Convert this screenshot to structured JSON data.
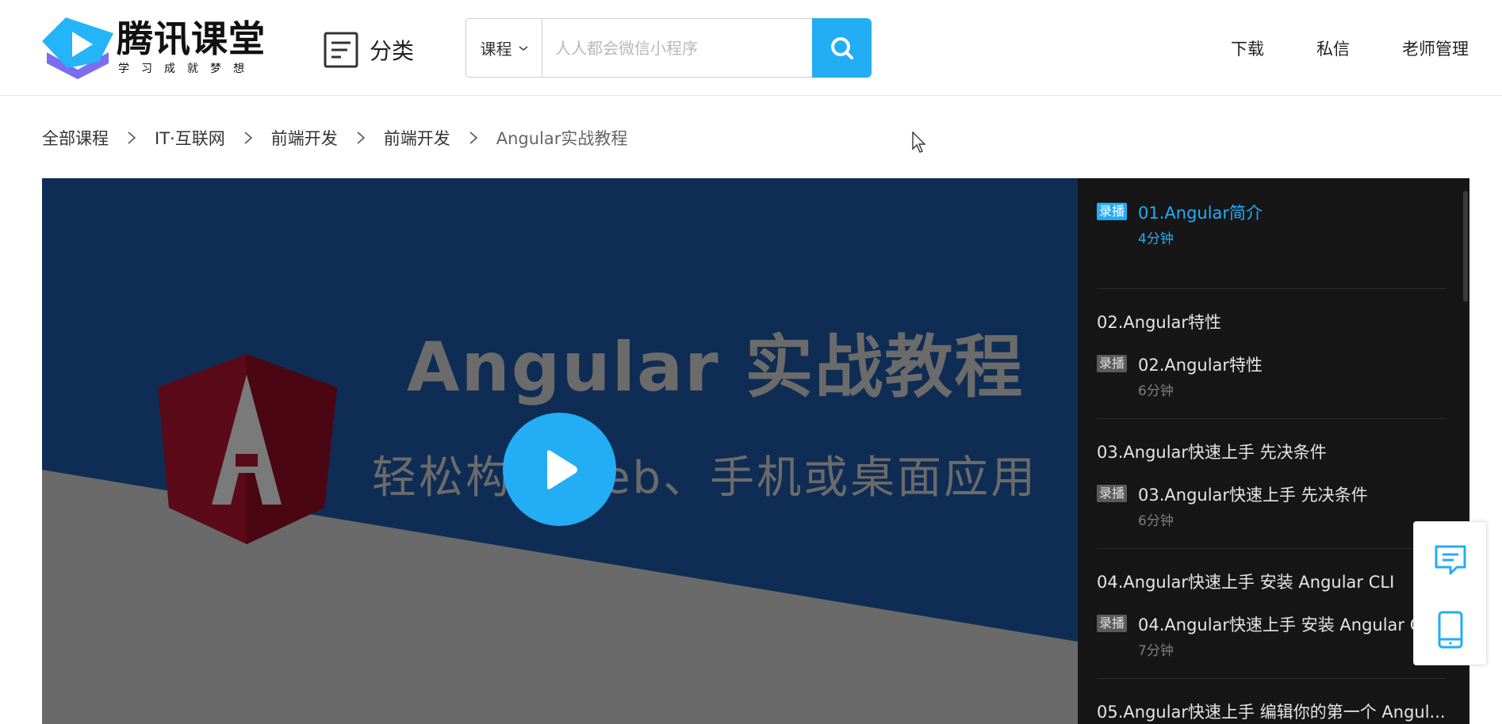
{
  "header": {
    "logo_title": "腾讯课堂",
    "logo_subtitle": "学习成就梦想",
    "category_label": "分类",
    "search": {
      "type_label": "课程",
      "placeholder": "人人都会微信小程序",
      "value": ""
    },
    "nav": [
      "下载",
      "私信",
      "老师管理"
    ]
  },
  "breadcrumb": [
    "全部课程",
    "IT·互联网",
    "前端开发",
    "前端开发",
    "Angular实战教程"
  ],
  "player": {
    "title": "Angular 实战教程",
    "subtitle": "轻松构建Web、手机或桌面应用",
    "logo_letter": "A"
  },
  "playlist": {
    "items": [
      {
        "chapter": "",
        "tag": "录播",
        "title": "01.Angular简介",
        "duration": "4分钟",
        "active": true
      },
      {
        "chapter": "02.Angular特性",
        "tag": "录播",
        "title": "02.Angular特性",
        "duration": "6分钟",
        "active": false
      },
      {
        "chapter": "03.Angular快速上手 先决条件",
        "tag": "录播",
        "title": "03.Angular快速上手 先决条件",
        "duration": "6分钟",
        "active": false
      },
      {
        "chapter": "04.Angular快速上手 安装 Angular CLI",
        "tag": "录播",
        "title": "04.Angular快速上手 安装 Angular C",
        "duration": "7分钟",
        "active": false
      },
      {
        "chapter": "05.Angular快速上手 编辑你的第一个 Angul...",
        "tag": "",
        "title": "",
        "duration": "",
        "active": false
      }
    ]
  },
  "colors": {
    "accent": "#23adf4",
    "player_bg": "#103361",
    "playlist_bg": "#161616"
  },
  "icons": [
    "category-icon",
    "chevron-down-icon",
    "search-icon",
    "play-icon",
    "message-icon",
    "mobile-icon",
    "cursor-icon"
  ]
}
